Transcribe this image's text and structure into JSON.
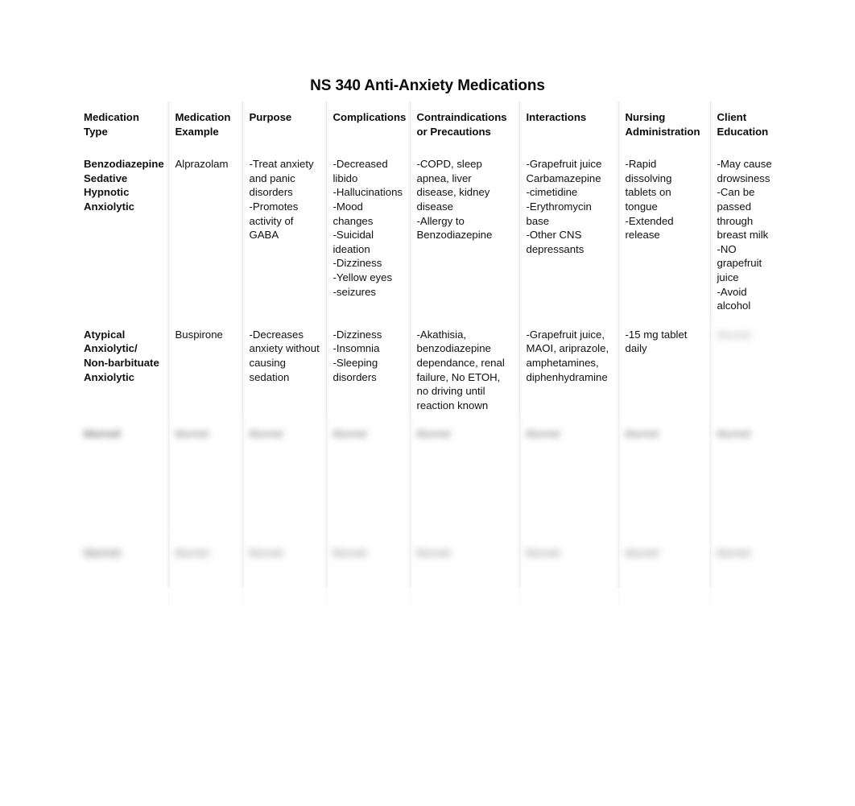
{
  "document": {
    "title": "NS 340 Anti-Anxiety Medications"
  },
  "table": {
    "headers": [
      "Medication Type",
      "Medication Example",
      "Purpose",
      "Complications",
      "Contraindications or Precautions",
      "Interactions",
      "Nursing Administration",
      "Client Education"
    ],
    "rows": [
      {
        "medication_type": "Benzodiazepine Sedative Hypnotic Anxiolytic",
        "medication_example": "Alprazolam",
        "purpose": "-Treat anxiety and panic disorders\n-Promotes activity of GABA",
        "complications": "-Decreased libido\n-Hallucinations\n-Mood changes\n-Suicidal ideation\n-Dizziness\n-Yellow eyes\n-seizures",
        "contraindications": "-COPD, sleep apnea, liver disease, kidney disease\n-Allergy to Benzodiazepine",
        "interactions": "-Grapefruit juice Carbamazepine\n-cimetidine\n-Erythromycin base\n-Other CNS depressants",
        "nursing_administration": "-Rapid dissolving tablets on tongue\n-Extended release",
        "client_education": "-May cause drowsiness\n-Can be passed through breast milk\n-NO grapefruit juice\n-Avoid alcohol"
      },
      {
        "medication_type": "Atypical Anxiolytic/ Non-barbituate Anxiolytic",
        "medication_example": "Buspirone",
        "purpose": "-Decreases anxiety without causing sedation",
        "complications": "-Dizziness\n-Insomnia\n-Sleeping disorders",
        "contraindications": "-Akathisia, benzodiazepine dependance, renal failure, No ETOH, no driving until reaction known",
        "interactions": "-Grapefruit juice, MAOI, ariprazole, amphetamines, diphenhydramine",
        "nursing_administration": "-15 mg tablet daily",
        "client_education": "blurred"
      },
      {
        "medication_type": "blurred",
        "medication_example": "blurred",
        "purpose": "blurred",
        "complications": "blurred",
        "contraindications": "blurred",
        "interactions": "blurred",
        "nursing_administration": "blurred",
        "client_education": "blurred"
      },
      {
        "medication_type": "blurred",
        "medication_example": "blurred",
        "purpose": "blurred",
        "complications": "blurred",
        "contraindications": "blurred",
        "interactions": "blurred",
        "nursing_administration": "blurred",
        "client_education": "blurred"
      }
    ]
  }
}
